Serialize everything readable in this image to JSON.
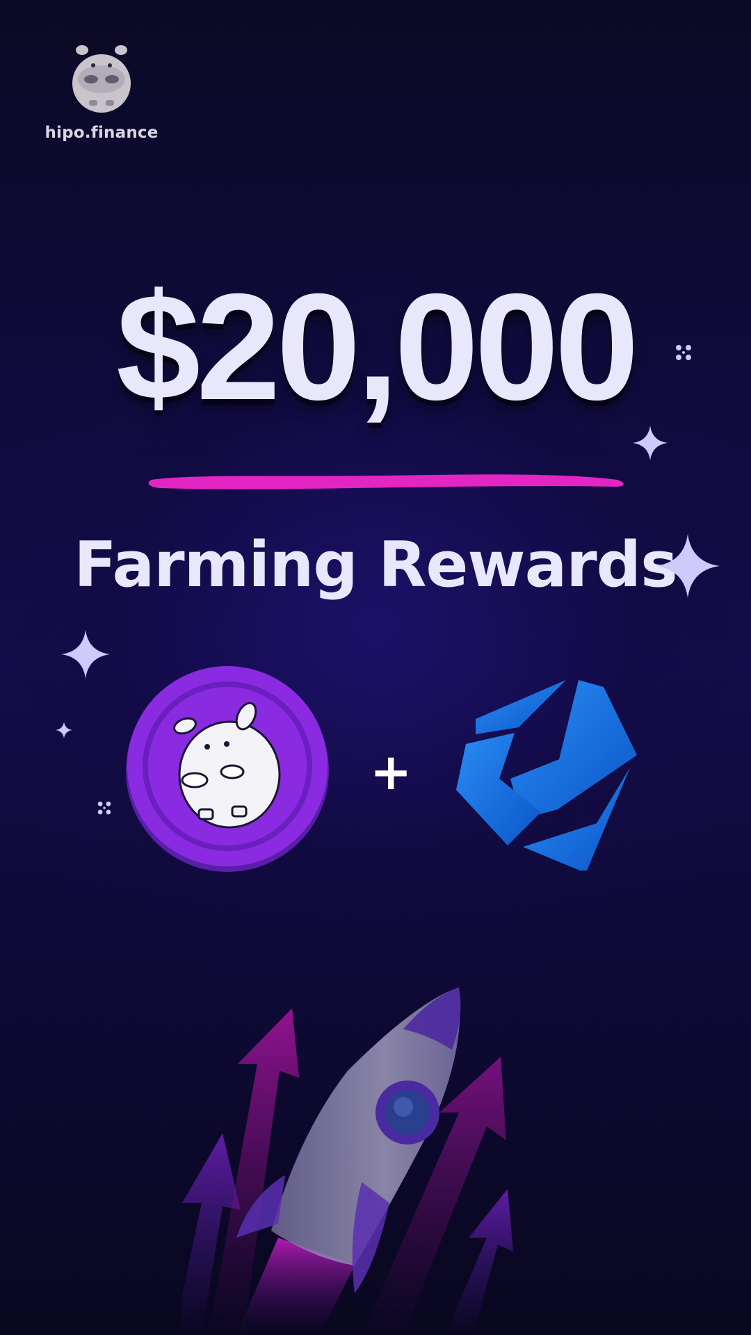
{
  "brand": {
    "name": "hipo.finance",
    "logo_icon": "hippo-mascot-icon"
  },
  "hero": {
    "amount": "$20,000",
    "subtitle": "Farming Rewards"
  },
  "tokens": {
    "left_icon": "hipo-token-icon",
    "separator": "+",
    "right_icon": "blue-gem-token-icon"
  },
  "decorations": {
    "sparkle_color": "#cfcafc",
    "underline_color": "#e325c4",
    "illustration": "rocket-launch-icon"
  },
  "colors": {
    "background": "#100b3d",
    "text": "#e9e7fb",
    "token_purple": "#8a2be2",
    "token_blue": "#1a7ae8"
  }
}
